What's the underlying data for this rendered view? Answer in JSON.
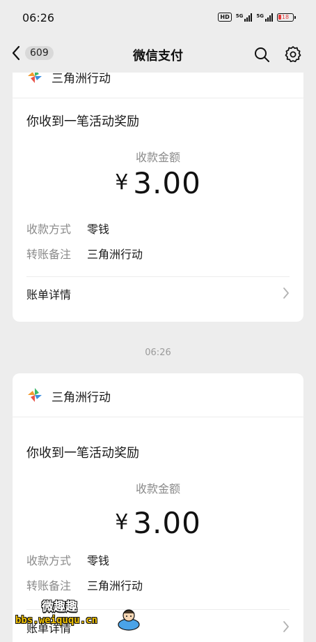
{
  "status_bar": {
    "time": "06:26",
    "hd_label": "HD",
    "signal1_label": "5G",
    "signal2_label": "5G",
    "battery": "18"
  },
  "nav": {
    "back_count": "609",
    "title": "微信支付",
    "search_icon": "search-icon",
    "settings_icon": "gear-icon"
  },
  "messages": [
    {
      "brand": "三角洲行动",
      "title": "你收到一笔活动奖励",
      "amount_label": "收款金额",
      "currency": "¥",
      "amount": "3.00",
      "method_key": "收款方式",
      "method_value": "零钱",
      "note_key": "转账备注",
      "note_value": "三角洲行动",
      "bill_label": "账单详情"
    },
    {
      "time": "06:26",
      "brand": "三角洲行动",
      "title": "你收到一笔活动奖励",
      "amount_label": "收款金额",
      "currency": "¥",
      "amount": "3.00",
      "method_key": "收款方式",
      "method_value": "零钱",
      "note_key": "转账备注",
      "note_value": "三角洲行动",
      "bill_label": "账单详情"
    }
  ],
  "watermark": {
    "line1": "微趣趣",
    "line2": "bbs.weiququ.cn"
  },
  "colors": {
    "background": "#ededed",
    "card": "#ffffff",
    "muted_text": "#8a8a8a",
    "logo_green": "#3cb96b",
    "logo_orange": "#f29a2e",
    "logo_red": "#e8534a",
    "logo_blue": "#3a8de0"
  }
}
